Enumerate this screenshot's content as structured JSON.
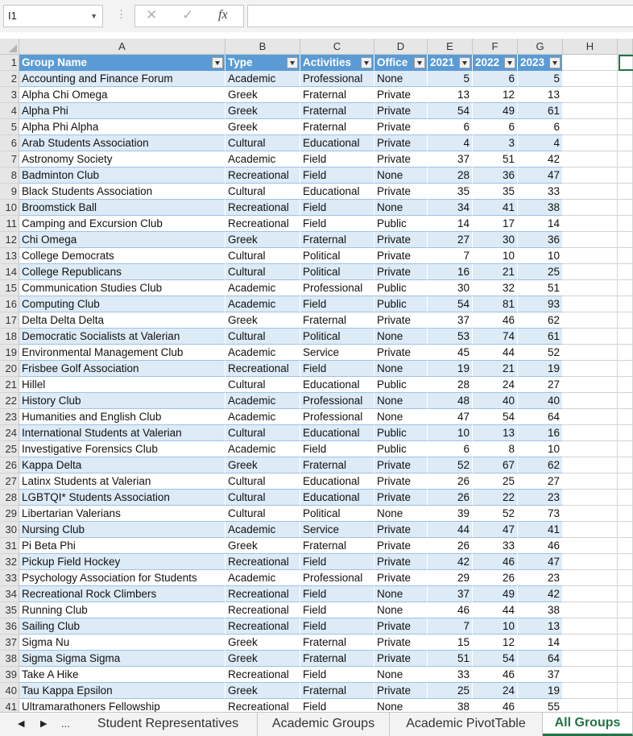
{
  "formula_bar": {
    "name_box": "I1",
    "dots": "⋮",
    "cancel_icon": "✕",
    "enter_icon": "✓",
    "fx_label": "fx",
    "formula_value": ""
  },
  "columns": [
    "A",
    "B",
    "C",
    "D",
    "E",
    "F",
    "G",
    "H"
  ],
  "table_header": [
    "Group Name",
    "Type",
    "Activities",
    "Office",
    "2021",
    "2022",
    "2023"
  ],
  "rows": [
    [
      "Accounting and Finance Forum",
      "Academic",
      "Professional",
      "None",
      "5",
      "6",
      "5"
    ],
    [
      "Alpha Chi Omega",
      "Greek",
      "Fraternal",
      "Private",
      "13",
      "12",
      "13"
    ],
    [
      "Alpha Phi",
      "Greek",
      "Fraternal",
      "Private",
      "54",
      "49",
      "61"
    ],
    [
      "Alpha Phi Alpha",
      "Greek",
      "Fraternal",
      "Private",
      "6",
      "6",
      "6"
    ],
    [
      "Arab Students Association",
      "Cultural",
      "Educational",
      "Private",
      "4",
      "3",
      "4"
    ],
    [
      "Astronomy Society",
      "Academic",
      "Field",
      "Private",
      "37",
      "51",
      "42"
    ],
    [
      "Badminton Club",
      "Recreational",
      "Field",
      "None",
      "28",
      "36",
      "47"
    ],
    [
      "Black Students Association",
      "Cultural",
      "Educational",
      "Private",
      "35",
      "35",
      "33"
    ],
    [
      "Broomstick Ball",
      "Recreational",
      "Field",
      "None",
      "34",
      "41",
      "38"
    ],
    [
      "Camping and Excursion Club",
      "Recreational",
      "Field",
      "Public",
      "14",
      "17",
      "14"
    ],
    [
      "Chi Omega",
      "Greek",
      "Fraternal",
      "Private",
      "27",
      "30",
      "36"
    ],
    [
      "College Democrats",
      "Cultural",
      "Political",
      "Private",
      "7",
      "10",
      "10"
    ],
    [
      "College Republicans",
      "Cultural",
      "Political",
      "Private",
      "16",
      "21",
      "25"
    ],
    [
      "Communication Studies Club",
      "Academic",
      "Professional",
      "Public",
      "30",
      "32",
      "51"
    ],
    [
      "Computing Club",
      "Academic",
      "Field",
      "Public",
      "54",
      "81",
      "93"
    ],
    [
      "Delta Delta Delta",
      "Greek",
      "Fraternal",
      "Private",
      "37",
      "46",
      "62"
    ],
    [
      "Democratic Socialists at Valerian",
      "Cultural",
      "Political",
      "None",
      "53",
      "74",
      "61"
    ],
    [
      "Environmental Management Club",
      "Academic",
      "Service",
      "Private",
      "45",
      "44",
      "52"
    ],
    [
      "Frisbee Golf Association",
      "Recreational",
      "Field",
      "None",
      "19",
      "21",
      "19"
    ],
    [
      "Hillel",
      "Cultural",
      "Educational",
      "Public",
      "28",
      "24",
      "27"
    ],
    [
      "History Club",
      "Academic",
      "Professional",
      "None",
      "48",
      "40",
      "40"
    ],
    [
      "Humanities and English Club",
      "Academic",
      "Professional",
      "None",
      "47",
      "54",
      "64"
    ],
    [
      "International Students at Valerian",
      "Cultural",
      "Educational",
      "Public",
      "10",
      "13",
      "16"
    ],
    [
      "Investigative Forensics Club",
      "Academic",
      "Field",
      "Public",
      "6",
      "8",
      "10"
    ],
    [
      "Kappa Delta",
      "Greek",
      "Fraternal",
      "Private",
      "52",
      "67",
      "62"
    ],
    [
      "Latinx Students at Valerian",
      "Cultural",
      "Educational",
      "Private",
      "26",
      "25",
      "27"
    ],
    [
      "LGBTQI* Students Association",
      "Cultural",
      "Educational",
      "Private",
      "26",
      "22",
      "23"
    ],
    [
      "Libertarian Valerians",
      "Cultural",
      "Political",
      "None",
      "39",
      "52",
      "73"
    ],
    [
      "Nursing Club",
      "Academic",
      "Service",
      "Private",
      "44",
      "47",
      "41"
    ],
    [
      "Pi Beta Phi",
      "Greek",
      "Fraternal",
      "Private",
      "26",
      "33",
      "46"
    ],
    [
      "Pickup Field Hockey",
      "Recreational",
      "Field",
      "Private",
      "42",
      "46",
      "47"
    ],
    [
      "Psychology Association for Students",
      "Academic",
      "Professional",
      "Private",
      "29",
      "26",
      "23"
    ],
    [
      "Recreational Rock Climbers",
      "Recreational",
      "Field",
      "None",
      "37",
      "49",
      "42"
    ],
    [
      "Running Club",
      "Recreational",
      "Field",
      "None",
      "46",
      "44",
      "38"
    ],
    [
      "Sailing Club",
      "Recreational",
      "Field",
      "Private",
      "7",
      "10",
      "13"
    ],
    [
      "Sigma Nu",
      "Greek",
      "Fraternal",
      "Private",
      "15",
      "12",
      "14"
    ],
    [
      "Sigma Sigma Sigma",
      "Greek",
      "Fraternal",
      "Private",
      "51",
      "54",
      "64"
    ],
    [
      "Take A Hike",
      "Recreational",
      "Field",
      "None",
      "33",
      "46",
      "37"
    ],
    [
      "Tau Kappa Epsilon",
      "Greek",
      "Fraternal",
      "Private",
      "25",
      "24",
      "19"
    ],
    [
      "Ultramarathoners Fellowship",
      "Recreational",
      "Field",
      "None",
      "38",
      "46",
      "55"
    ]
  ],
  "row_numbers": [
    "1",
    "2",
    "3",
    "4",
    "5",
    "6",
    "7",
    "8",
    "9",
    "10",
    "11",
    "12",
    "13",
    "14",
    "15",
    "16",
    "17",
    "18",
    "19",
    "20",
    "21",
    "22",
    "23",
    "24",
    "25",
    "26",
    "27",
    "28",
    "29",
    "30",
    "31",
    "32",
    "33",
    "34",
    "35",
    "36",
    "37",
    "38",
    "39",
    "40",
    "41"
  ],
  "sheet_tabs": {
    "prev_icon": "◀",
    "next_icon": "▶",
    "more": "...",
    "tabs": [
      "Student Representatives",
      "Academic Groups",
      "Academic PivotTable",
      "All Groups"
    ],
    "active": "All Groups"
  },
  "colors": {
    "header_fill": "#5b9bd5",
    "band_fill": "#ddebf7",
    "accent": "#217346"
  }
}
